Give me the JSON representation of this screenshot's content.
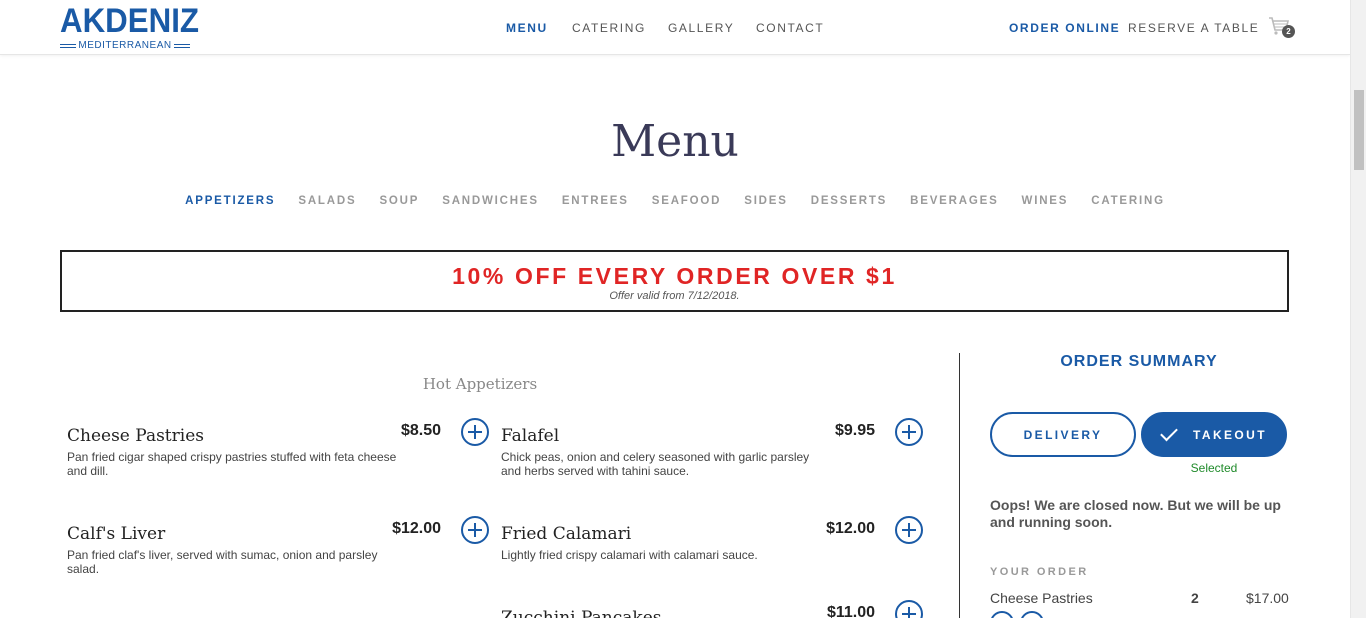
{
  "header": {
    "logo_main": "AKDENIZ",
    "logo_sub": "MEDITERRANEAN",
    "nav": [
      "MENU",
      "CATERING",
      "GALLERY",
      "CONTACT"
    ],
    "order_online": "ORDER ONLINE",
    "reserve": "RESERVE A TABLE",
    "cart_count": "2"
  },
  "page_title": "Menu",
  "categories": [
    "APPETIZERS",
    "SALADS",
    "SOUP",
    "SANDWICHES",
    "ENTREES",
    "SEAFOOD",
    "SIDES",
    "DESSERTS",
    "BEVERAGES",
    "WINES",
    "CATERING"
  ],
  "promo": {
    "title": "10% OFF EVERY ORDER OVER $1",
    "subtitle": "Offer valid from 7/12/2018."
  },
  "section": "Hot Appetizers",
  "items": [
    {
      "name": "Cheese Pastries",
      "price": "$8.50",
      "desc": "Pan fried cigar shaped crispy pastries stuffed with feta cheese and dill."
    },
    {
      "name": "Falafel",
      "price": "$9.95",
      "desc": "Chick peas, onion and celery seasoned with garlic parsley and herbs served with tahini sauce."
    },
    {
      "name": "Calf's Liver",
      "price": "$12.00",
      "desc": "Pan fried claf's liver, served with sumac, onion and parsley salad."
    },
    {
      "name": "Fried Calamari",
      "price": "$12.00",
      "desc": "Lightly fried crispy calamari with calamari sauce."
    },
    {
      "name": "Zucchini Pancakes",
      "price": "$11.00",
      "desc": ""
    }
  ],
  "summary": {
    "title": "ORDER SUMMARY",
    "delivery": "DELIVERY",
    "takeout": "TAKEOUT",
    "selected": "Selected",
    "closed": "Oops! We are closed now. But we will be up and running soon.",
    "your_order": "YOUR ORDER",
    "line_item": "Cheese Pastries",
    "line_qty": "2",
    "line_total": "$17.00"
  },
  "colors": {
    "brand": "#1a5aa6",
    "promo": "#e02525",
    "selected": "#1f8a2a"
  }
}
